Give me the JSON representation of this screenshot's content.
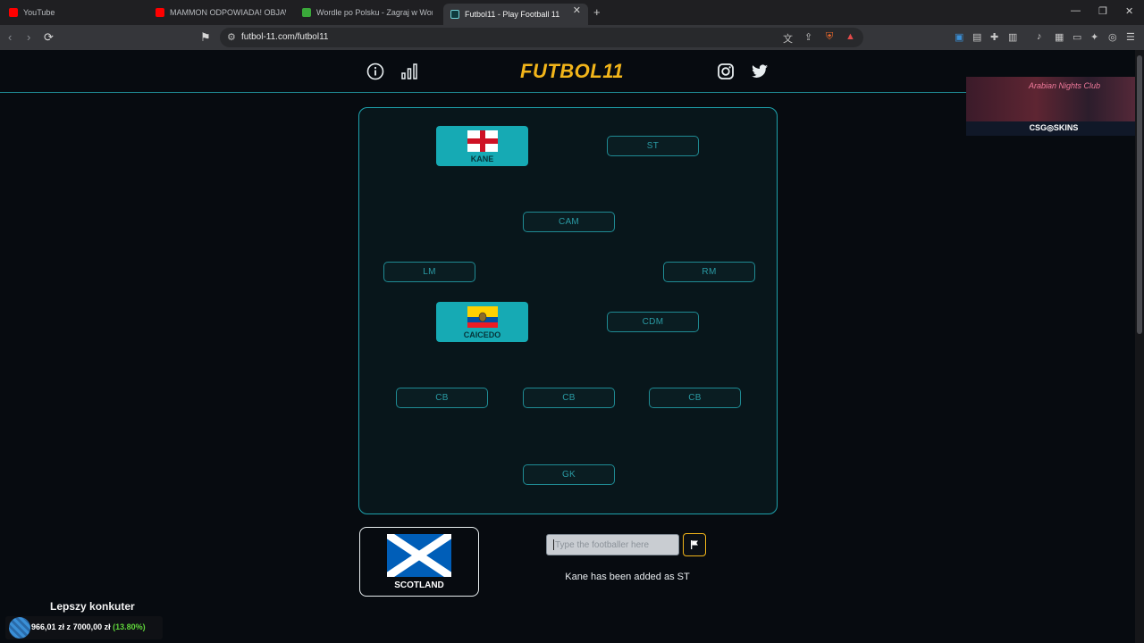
{
  "browser": {
    "tabs": [
      {
        "title": "YouTube",
        "fav_color": "#ff0000"
      },
      {
        "title": "MAMMON ODPOWIADA! OBJAWIEN",
        "fav_color": "#ff0000"
      },
      {
        "title": "Wordle po Polsku - Zagraj w Wordle",
        "fav_color": "#3aa83a"
      },
      {
        "title": "Futbol11 - Play Football 11",
        "fav_color": "#0f3a3e",
        "active": true
      }
    ],
    "url": "futbol-11.com/futbol11"
  },
  "header": {
    "logo": "FUTBOL11",
    "icons": [
      "info-icon",
      "stats-icon",
      "instagram-icon",
      "twitter-icon"
    ]
  },
  "formation": {
    "slots": {
      "st_right": "ST",
      "cam": "CAM",
      "lm": "LM",
      "rm": "RM",
      "cdm": "CDM",
      "cb_left": "CB",
      "cb_mid": "CB",
      "cb_right": "CB",
      "gk": "GK"
    },
    "players": {
      "kane": {
        "name": "KANE",
        "flag": "England"
      },
      "caicedo": {
        "name": "CAICEDO",
        "flag": "Ecuador"
      }
    }
  },
  "clue": {
    "country": "SCOTLAND"
  },
  "guess": {
    "placeholder": "Type the footballer here",
    "status": "Kane has been added as ST"
  },
  "ad": {
    "brand": "CSG◎SKINS",
    "script": "Arabian Nights Club"
  },
  "overlay": {
    "title": "Lepszy konkuter",
    "amount": "966,01 zł",
    "of": "z",
    "goal": "7000,00 zł",
    "percent": "(13.80%)"
  },
  "colors": {
    "accent": "#1ea2ad",
    "logo": "#f2b51a",
    "card": "#16aab4"
  }
}
